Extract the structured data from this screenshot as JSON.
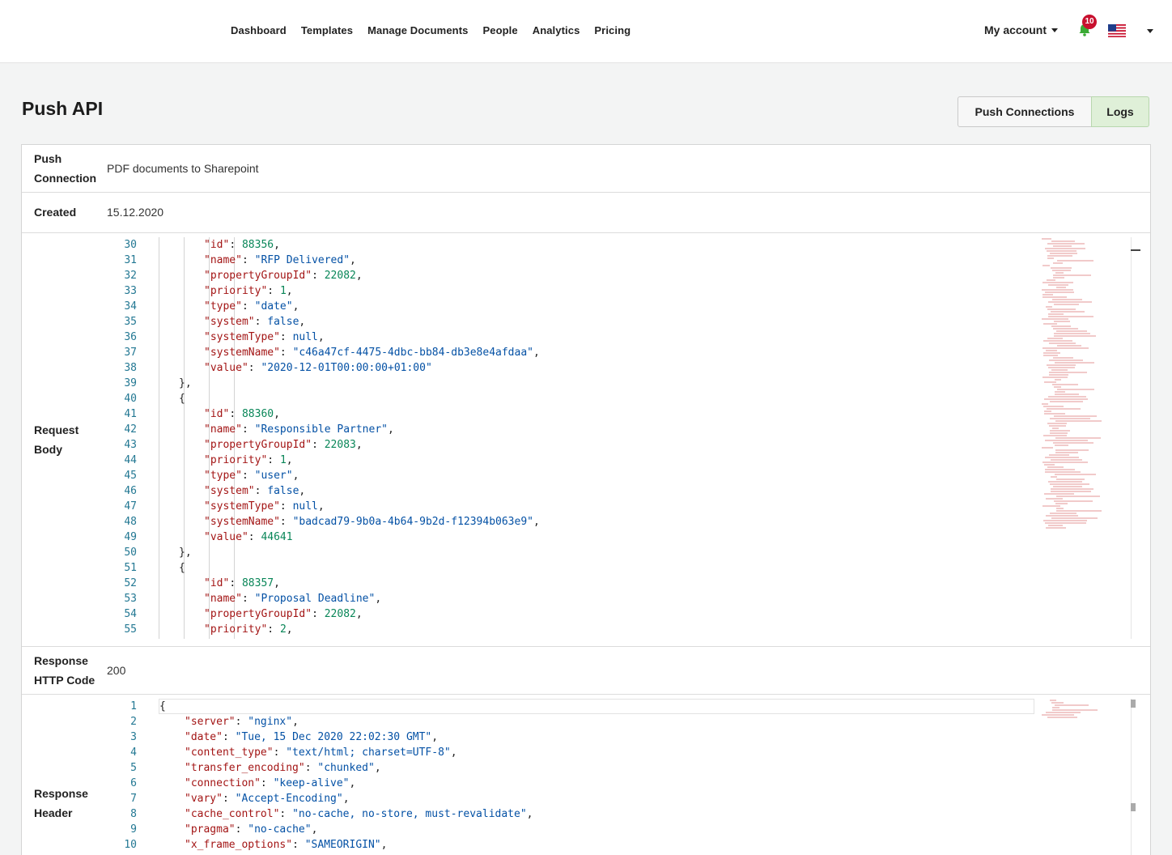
{
  "nav": {
    "items": [
      "Dashboard",
      "Templates",
      "Manage Documents",
      "People",
      "Analytics",
      "Pricing"
    ],
    "account_label": "My account",
    "notification_count": "10"
  },
  "page": {
    "title": "Push API",
    "buttons": {
      "push_connections": "Push Connections",
      "logs": "Logs"
    },
    "active_tab": "Logs"
  },
  "details": {
    "push_connection_label": "Push Connection",
    "push_connection_value": "PDF documents to Sharepoint",
    "created_label": "Created",
    "created_value": "15.12.2020",
    "request_body_label": "Request Body",
    "response_code_label": "Response HTTP Code",
    "response_code_value": "200",
    "response_header_label": "Response Header"
  },
  "request_body_lines": [
    {
      "n": "30",
      "i": 4,
      "t": [
        [
          "k",
          "\"id\""
        ],
        [
          "p",
          ": "
        ],
        [
          "n",
          "88356"
        ],
        [
          "p",
          ","
        ]
      ]
    },
    {
      "n": "31",
      "i": 4,
      "t": [
        [
          "k",
          "\"name\""
        ],
        [
          "p",
          ": "
        ],
        [
          "s",
          "\"RFP Delivered\""
        ],
        [
          "p",
          ","
        ]
      ]
    },
    {
      "n": "32",
      "i": 4,
      "t": [
        [
          "k",
          "\"propertyGroupId\""
        ],
        [
          "p",
          ": "
        ],
        [
          "n",
          "22082"
        ],
        [
          "p",
          ","
        ]
      ]
    },
    {
      "n": "33",
      "i": 4,
      "t": [
        [
          "k",
          "\"priority\""
        ],
        [
          "p",
          ": "
        ],
        [
          "n",
          "1"
        ],
        [
          "p",
          ","
        ]
      ]
    },
    {
      "n": "34",
      "i": 4,
      "t": [
        [
          "k",
          "\"type\""
        ],
        [
          "p",
          ": "
        ],
        [
          "s",
          "\"date\""
        ],
        [
          "p",
          ","
        ]
      ]
    },
    {
      "n": "35",
      "i": 4,
      "t": [
        [
          "k",
          "\"system\""
        ],
        [
          "p",
          ": "
        ],
        [
          "s",
          "false"
        ],
        [
          "p",
          ","
        ]
      ]
    },
    {
      "n": "36",
      "i": 4,
      "t": [
        [
          "k",
          "\"systemType\""
        ],
        [
          "p",
          ": "
        ],
        [
          "s",
          "null"
        ],
        [
          "p",
          ","
        ]
      ]
    },
    {
      "n": "37",
      "i": 4,
      "t": [
        [
          "k",
          "\"systemName\""
        ],
        [
          "p",
          ": "
        ],
        [
          "s",
          "\"c46a47cf-4475-4dbc-bb84-db3e8e4afdaa\""
        ],
        [
          "p",
          ","
        ]
      ]
    },
    {
      "n": "38",
      "i": 4,
      "t": [
        [
          "k",
          "\"value\""
        ],
        [
          "p",
          ": "
        ],
        [
          "s",
          "\"2020-12-01T00:00:00+01:00\""
        ]
      ]
    },
    {
      "n": "39",
      "i": 3,
      "t": [
        [
          "p",
          "},"
        ]
      ]
    },
    {
      "n": "40",
      "i": 3,
      "t": [
        [
          "p",
          "{"
        ]
      ]
    },
    {
      "n": "41",
      "i": 4,
      "t": [
        [
          "k",
          "\"id\""
        ],
        [
          "p",
          ": "
        ],
        [
          "n",
          "88360"
        ],
        [
          "p",
          ","
        ]
      ]
    },
    {
      "n": "42",
      "i": 4,
      "t": [
        [
          "k",
          "\"name\""
        ],
        [
          "p",
          ": "
        ],
        [
          "s",
          "\"Responsible Partner\""
        ],
        [
          "p",
          ","
        ]
      ]
    },
    {
      "n": "43",
      "i": 4,
      "t": [
        [
          "k",
          "\"propertyGroupId\""
        ],
        [
          "p",
          ": "
        ],
        [
          "n",
          "22083"
        ],
        [
          "p",
          ","
        ]
      ]
    },
    {
      "n": "44",
      "i": 4,
      "t": [
        [
          "k",
          "\"priority\""
        ],
        [
          "p",
          ": "
        ],
        [
          "n",
          "1"
        ],
        [
          "p",
          ","
        ]
      ]
    },
    {
      "n": "45",
      "i": 4,
      "t": [
        [
          "k",
          "\"type\""
        ],
        [
          "p",
          ": "
        ],
        [
          "s",
          "\"user\""
        ],
        [
          "p",
          ","
        ]
      ]
    },
    {
      "n": "46",
      "i": 4,
      "t": [
        [
          "k",
          "\"system\""
        ],
        [
          "p",
          ": "
        ],
        [
          "s",
          "false"
        ],
        [
          "p",
          ","
        ]
      ]
    },
    {
      "n": "47",
      "i": 4,
      "t": [
        [
          "k",
          "\"systemType\""
        ],
        [
          "p",
          ": "
        ],
        [
          "s",
          "null"
        ],
        [
          "p",
          ","
        ]
      ]
    },
    {
      "n": "48",
      "i": 4,
      "t": [
        [
          "k",
          "\"systemName\""
        ],
        [
          "p",
          ": "
        ],
        [
          "s",
          "\"badcad79-9b0a-4b64-9b2d-f12394b063e9\""
        ],
        [
          "p",
          ","
        ]
      ]
    },
    {
      "n": "49",
      "i": 4,
      "t": [
        [
          "k",
          "\"value\""
        ],
        [
          "p",
          ": "
        ],
        [
          "n",
          "44641"
        ]
      ]
    },
    {
      "n": "50",
      "i": 3,
      "t": [
        [
          "p",
          "},"
        ]
      ]
    },
    {
      "n": "51",
      "i": 3,
      "t": [
        [
          "p",
          "{"
        ]
      ]
    },
    {
      "n": "52",
      "i": 4,
      "t": [
        [
          "k",
          "\"id\""
        ],
        [
          "p",
          ": "
        ],
        [
          "n",
          "88357"
        ],
        [
          "p",
          ","
        ]
      ]
    },
    {
      "n": "53",
      "i": 4,
      "t": [
        [
          "k",
          "\"name\""
        ],
        [
          "p",
          ": "
        ],
        [
          "s",
          "\"Proposal Deadline\""
        ],
        [
          "p",
          ","
        ]
      ]
    },
    {
      "n": "54",
      "i": 4,
      "t": [
        [
          "k",
          "\"propertyGroupId\""
        ],
        [
          "p",
          ": "
        ],
        [
          "n",
          "22082"
        ],
        [
          "p",
          ","
        ]
      ]
    },
    {
      "n": "55",
      "i": 4,
      "t": [
        [
          "k",
          "\"priority\""
        ],
        [
          "p",
          ": "
        ],
        [
          "n",
          "2"
        ],
        [
          "p",
          ","
        ]
      ]
    }
  ],
  "response_header_lines": [
    {
      "n": "1",
      "i": 0,
      "t": [
        [
          "p",
          "{"
        ]
      ]
    },
    {
      "n": "2",
      "i": 1,
      "t": [
        [
          "k",
          "\"server\""
        ],
        [
          "p",
          ": "
        ],
        [
          "s",
          "\"nginx\""
        ],
        [
          "p",
          ","
        ]
      ]
    },
    {
      "n": "3",
      "i": 1,
      "t": [
        [
          "k",
          "\"date\""
        ],
        [
          "p",
          ": "
        ],
        [
          "s",
          "\"Tue, 15 Dec 2020 22:02:30 GMT\""
        ],
        [
          "p",
          ","
        ]
      ]
    },
    {
      "n": "4",
      "i": 1,
      "t": [
        [
          "k",
          "\"content_type\""
        ],
        [
          "p",
          ": "
        ],
        [
          "s",
          "\"text/html; charset=UTF-8\""
        ],
        [
          "p",
          ","
        ]
      ]
    },
    {
      "n": "5",
      "i": 1,
      "t": [
        [
          "k",
          "\"transfer_encoding\""
        ],
        [
          "p",
          ": "
        ],
        [
          "s",
          "\"chunked\""
        ],
        [
          "p",
          ","
        ]
      ]
    },
    {
      "n": "6",
      "i": 1,
      "t": [
        [
          "k",
          "\"connection\""
        ],
        [
          "p",
          ": "
        ],
        [
          "s",
          "\"keep-alive\""
        ],
        [
          "p",
          ","
        ]
      ]
    },
    {
      "n": "7",
      "i": 1,
      "t": [
        [
          "k",
          "\"vary\""
        ],
        [
          "p",
          ": "
        ],
        [
          "s",
          "\"Accept-Encoding\""
        ],
        [
          "p",
          ","
        ]
      ]
    },
    {
      "n": "8",
      "i": 1,
      "t": [
        [
          "k",
          "\"cache_control\""
        ],
        [
          "p",
          ": "
        ],
        [
          "s",
          "\"no-cache, no-store, must-revalidate\""
        ],
        [
          "p",
          ","
        ]
      ]
    },
    {
      "n": "9",
      "i": 1,
      "t": [
        [
          "k",
          "\"pragma\""
        ],
        [
          "p",
          ": "
        ],
        [
          "s",
          "\"no-cache\""
        ],
        [
          "p",
          ","
        ]
      ]
    },
    {
      "n": "10",
      "i": 1,
      "t": [
        [
          "k",
          "\"x_frame_options\""
        ],
        [
          "p",
          ": "
        ],
        [
          "s",
          "\"SAMEORIGIN\""
        ],
        [
          "p",
          ","
        ]
      ]
    }
  ],
  "colors": {
    "key": "#a31515",
    "string": "#0451a5",
    "number": "#098658",
    "line_number": "#237893",
    "logs_active": "#dff0d8",
    "badge": "#c8102e"
  },
  "icons": {
    "notification": "bell-icon",
    "language": "us-flag-icon"
  }
}
